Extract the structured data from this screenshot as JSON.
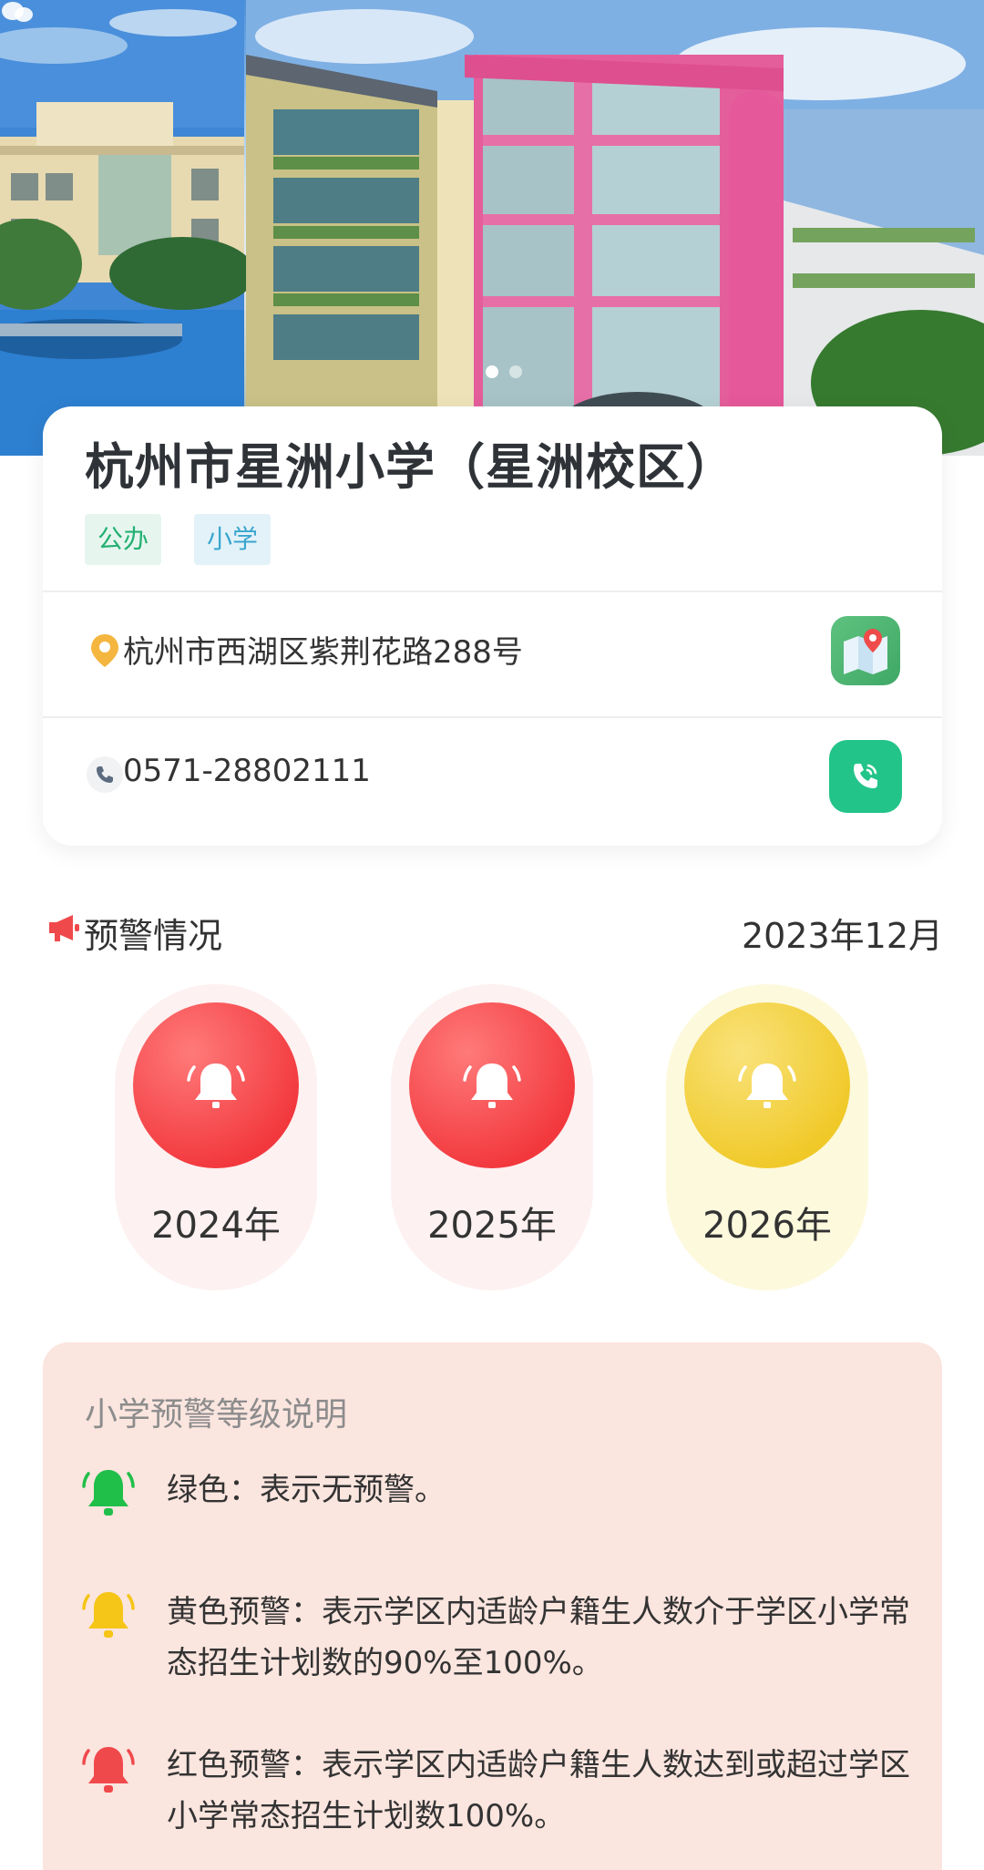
{
  "school": {
    "name": "杭州市星洲小学（星洲校区）",
    "tags": [
      "公办",
      "小学"
    ],
    "address": "杭州市西湖区紫荆花路288号",
    "phone": "0571-28802111"
  },
  "icons": {
    "address": "location-pin-icon",
    "map": "map-navigation-icon",
    "phone": "phone-icon",
    "call": "phone-call-icon",
    "warning": "megaphone-icon",
    "level": "bell-icon"
  },
  "warning": {
    "title": "预警情况",
    "date": "2023年12月",
    "years": [
      {
        "label": "2024年",
        "level": "red",
        "color": "#f2383d"
      },
      {
        "label": "2025年",
        "level": "red",
        "color": "#f2383d"
      },
      {
        "label": "2026年",
        "level": "yellow",
        "color": "#f0c928"
      }
    ]
  },
  "legend": {
    "title": "小学预警等级说明",
    "items": [
      {
        "level": "green",
        "color": "#1fbf4a",
        "text": "绿色：表示无预警。"
      },
      {
        "level": "yellow",
        "color": "#f5c518",
        "text": "黄色预警：表示学区内适龄户籍生人数介于学区小学常态招生计划数的90%至100%。"
      },
      {
        "level": "red",
        "color": "#f0494c",
        "text": "红色预警：表示学区内适龄户籍生人数达到或超过学区小学常态招生计划数100%。"
      }
    ]
  },
  "banner": {
    "slide_count": 2,
    "active_slide": 1
  }
}
